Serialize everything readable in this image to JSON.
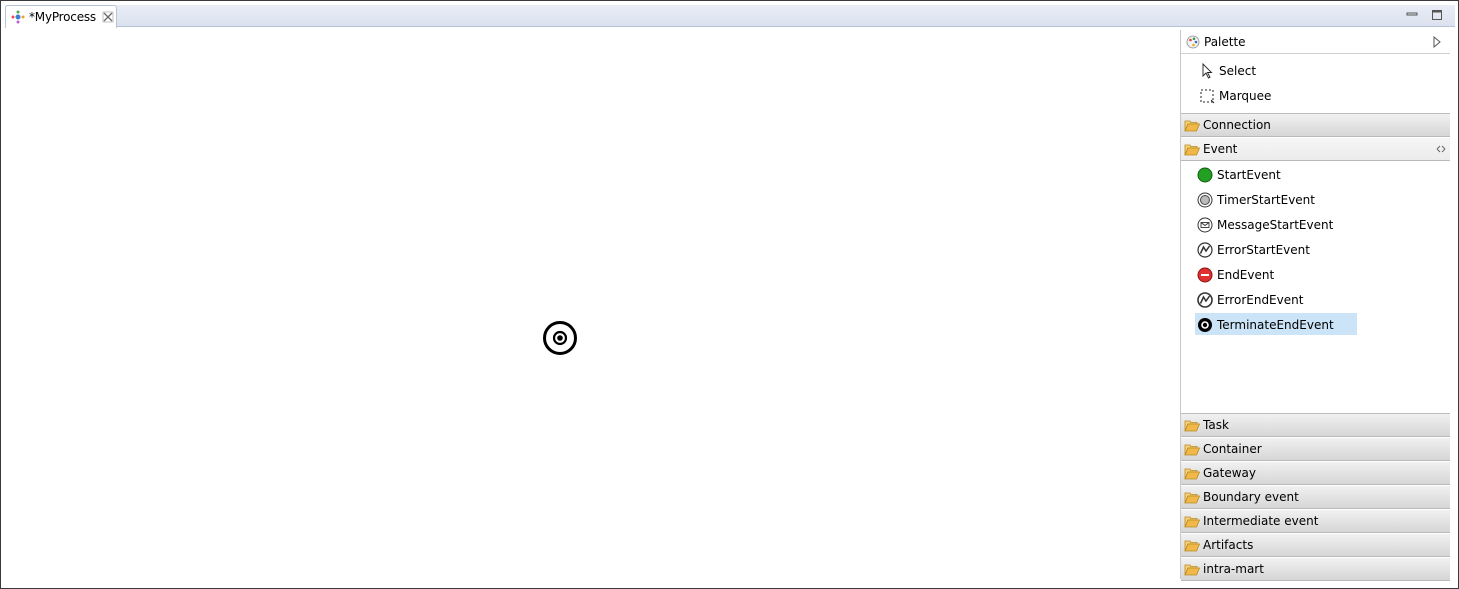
{
  "editor": {
    "tab_title": "*MyProcess"
  },
  "palette": {
    "title": "Palette",
    "tools": [
      {
        "label": "Select",
        "icon": "arrow-cursor-icon"
      },
      {
        "label": "Marquee",
        "icon": "marquee-icon"
      }
    ],
    "drawers_before": [
      {
        "label": "Connection",
        "open": false
      }
    ],
    "open_drawer": {
      "label": "Event",
      "items": [
        {
          "label": "StartEvent",
          "icon": "start-event-icon"
        },
        {
          "label": "TimerStartEvent",
          "icon": "timer-start-event-icon"
        },
        {
          "label": "MessageStartEvent",
          "icon": "message-start-event-icon"
        },
        {
          "label": "ErrorStartEvent",
          "icon": "error-start-event-icon"
        },
        {
          "label": "EndEvent",
          "icon": "end-event-icon"
        },
        {
          "label": "ErrorEndEvent",
          "icon": "error-end-event-icon"
        },
        {
          "label": "TerminateEndEvent",
          "icon": "terminate-end-event-icon",
          "selected": true
        }
      ]
    },
    "drawers_after": [
      {
        "label": "Task"
      },
      {
        "label": "Container"
      },
      {
        "label": "Gateway"
      },
      {
        "label": "Boundary event"
      },
      {
        "label": "Intermediate event"
      },
      {
        "label": "Artifacts"
      },
      {
        "label": "intra-mart"
      }
    ]
  },
  "colors": {
    "start_event": "#22a022",
    "end_event": "#e03030",
    "selection": "#cce4f7",
    "folder": "#f0b848"
  }
}
